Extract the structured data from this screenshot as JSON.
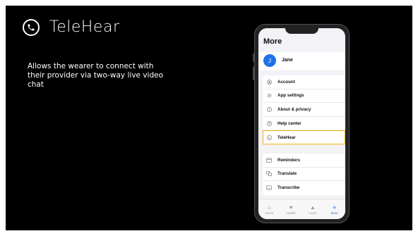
{
  "slide": {
    "title": "TeleHear",
    "title_icon": "phone-icon",
    "description": "Allows the wearer to connect with their provider via two-way live video chat"
  },
  "phone_screen": {
    "header": "More",
    "user": {
      "initial": "J",
      "name": "Jane"
    },
    "menu_group_1": [
      {
        "icon": "account-icon",
        "label": "Account"
      },
      {
        "icon": "gear-icon",
        "label": "App settings"
      },
      {
        "icon": "info-icon",
        "label": "About & privacy"
      },
      {
        "icon": "help-icon",
        "label": "Help center"
      },
      {
        "icon": "phone-icon",
        "label": "TeleHear",
        "highlighted": true
      }
    ],
    "menu_group_2": [
      {
        "icon": "calendar-icon",
        "label": "Reminders"
      },
      {
        "icon": "translate-icon",
        "label": "Translate"
      },
      {
        "icon": "transcribe-icon",
        "label": "Transcribe"
      }
    ],
    "tabs": [
      {
        "icon": "home-icon",
        "label": "Home"
      },
      {
        "icon": "heart-icon",
        "label": "Health"
      },
      {
        "icon": "learn-icon",
        "label": "Learn"
      },
      {
        "icon": "menu-icon",
        "label": "More",
        "active": true
      }
    ],
    "colors": {
      "accent": "#1e73e8",
      "highlight": "#f2b705",
      "background": "#000000"
    }
  }
}
